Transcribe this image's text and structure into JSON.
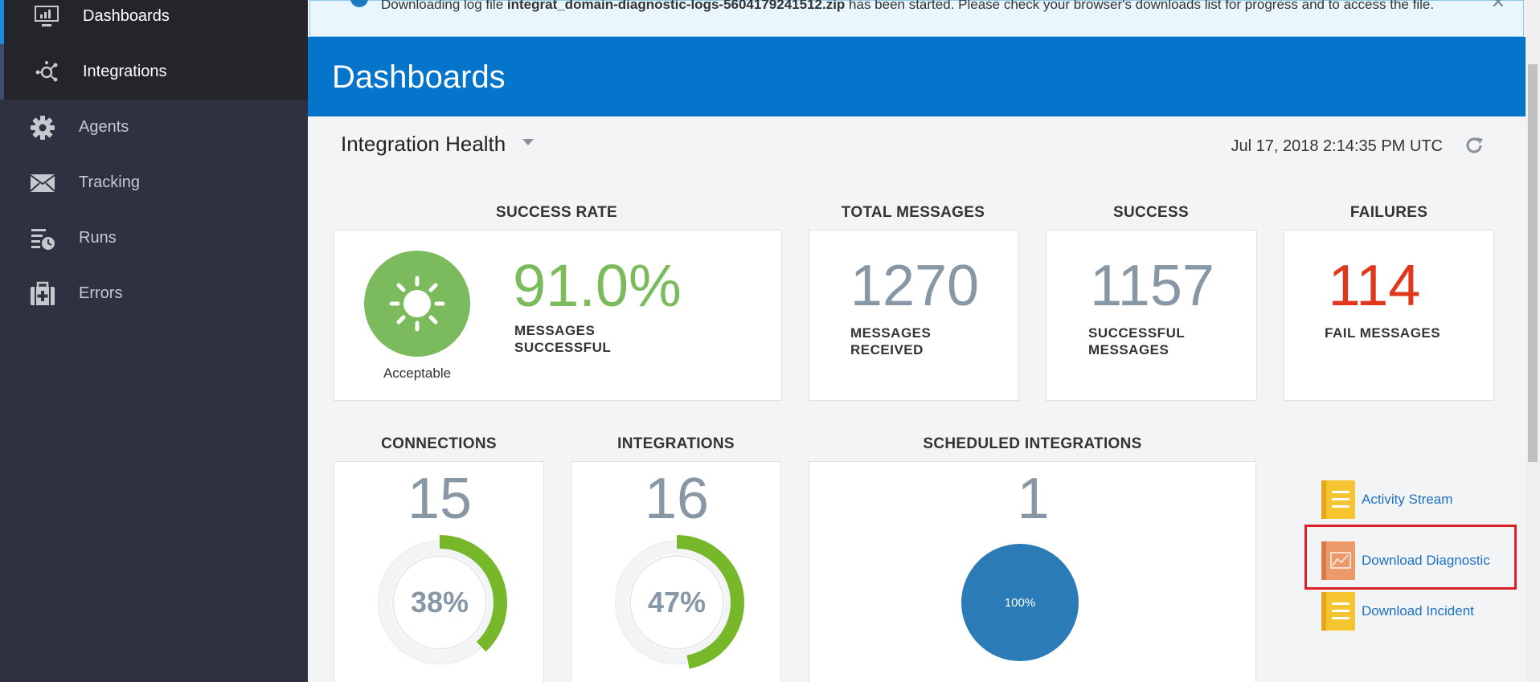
{
  "sidebar": {
    "items": [
      {
        "label": "Dashboards",
        "icon": "monitor-chart-icon"
      },
      {
        "label": "Integrations",
        "icon": "integrations-icon"
      },
      {
        "label": "Agents",
        "icon": "gear-icon"
      },
      {
        "label": "Tracking",
        "icon": "envelope-icon"
      },
      {
        "label": "Runs",
        "icon": "runs-clock-icon"
      },
      {
        "label": "Errors",
        "icon": "medkit-icon"
      }
    ]
  },
  "banner": {
    "text_prefix": "Downloading log file ",
    "filename": "integrat_domain-diagnostic-logs-5604179241512.zip",
    "text_suffix": " has been started. Please check your browser's downloads list for progress and to access the file.",
    "close": "✕"
  },
  "header": {
    "title": "Dashboards"
  },
  "toolbar": {
    "view": "Integration Health",
    "timestamp": "Jul 17, 2018 2:14:35 PM UTC"
  },
  "success_rate": {
    "title": "SUCCESS RATE",
    "value": "91.0%",
    "label_line1": "MESSAGES",
    "label_line2": "SUCCESSFUL",
    "status": "Acceptable",
    "status_color": "#7cbb5d"
  },
  "total_messages": {
    "title": "TOTAL MESSAGES",
    "value": "1270",
    "label_line1": "MESSAGES",
    "label_line2": "RECEIVED"
  },
  "success": {
    "title": "SUCCESS",
    "value": "1157",
    "label_line1": "SUCCESSFUL",
    "label_line2": "MESSAGES"
  },
  "failures": {
    "title": "FAILURES",
    "value": "114",
    "label": "FAIL MESSAGES",
    "color": "#e0371d"
  },
  "connections": {
    "title": "CONNECTIONS",
    "value": "15",
    "percent_label": "38%",
    "percent": 0.38
  },
  "integrations": {
    "title": "INTEGRATIONS",
    "value": "16",
    "percent_label": "47%",
    "percent": 0.47
  },
  "scheduled": {
    "title": "SCHEDULED INTEGRATIONS",
    "value": "1",
    "pie_label": "100%",
    "pie_color": "#2a7bb6"
  },
  "links": {
    "activity": "Activity Stream",
    "diagnostic": "Download Diagnostic",
    "incident": "Download Incident"
  },
  "colors": {
    "accent": "#0575cb",
    "ring": "#76b82a",
    "sidebar": "#2e3240"
  }
}
